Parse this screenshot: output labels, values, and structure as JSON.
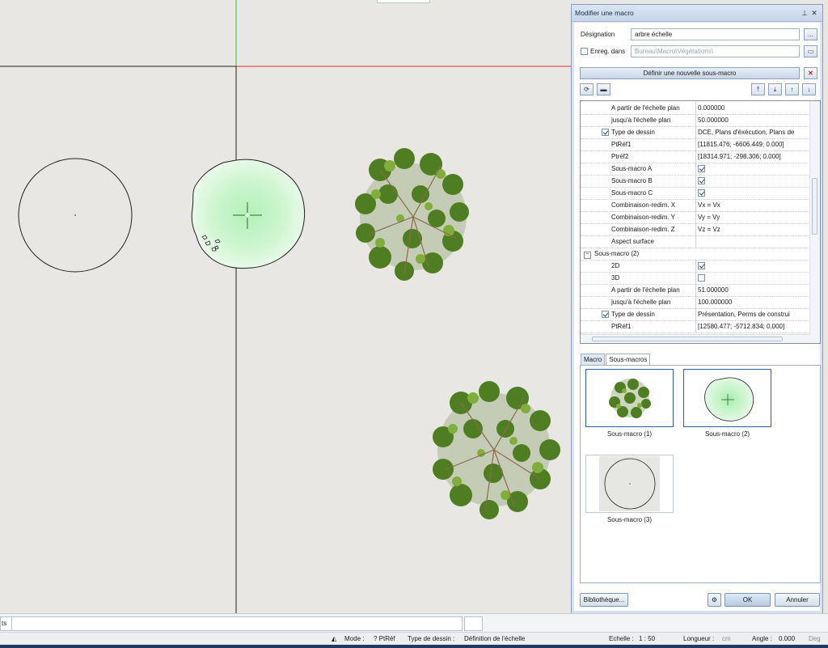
{
  "panel": {
    "title": "Modifier une macro",
    "pin_icon": "pin-icon",
    "close_glyph": "✕",
    "designation_label": "Désignation",
    "designation_value": "arbre échelle",
    "browse_label": "...",
    "enreg_label": "Enreg. dans",
    "enreg_path": "Bureau\\Macro\\Végétations\\",
    "define_button": "Définir une nouvelle sous-macro",
    "grid_rows": [
      {
        "key": "A partir de l'échelle plan",
        "value": "0.000000"
      },
      {
        "key": "jusqu'à l'échelle plan",
        "value": "50.000000"
      },
      {
        "key": "Type de dessin",
        "value": "DCE, Plans d'éxécution, Plans de",
        "checked_key": true
      },
      {
        "key": "PtRéf1",
        "value": "[11815.476; -6606.449; 0.000]"
      },
      {
        "key": "Ptréf2",
        "value": "[18314.971; -298.306; 0.000]"
      },
      {
        "key": "Sous-macro A",
        "check": true
      },
      {
        "key": "Sous-macro B",
        "check": true
      },
      {
        "key": "Sous-macro C",
        "check": true
      },
      {
        "key": "Combinaison-redim. X",
        "value": "Vx = Vx"
      },
      {
        "key": "Combinaison-redim. Y",
        "value": "Vy = Vy"
      },
      {
        "key": "Combinaison-redim. Z",
        "value": "Vz = Vz"
      },
      {
        "key": "Aspect surface",
        "value": ""
      },
      {
        "key": "Sous-macro (2)",
        "group": true
      },
      {
        "key": "2D",
        "check": true
      },
      {
        "key": "3D",
        "check": false
      },
      {
        "key": "A partir de l'échelle plan",
        "value": "51.000000"
      },
      {
        "key": "jusqu'à l'échelle plan",
        "value": "100.000000"
      },
      {
        "key": "Type de dessin",
        "value": "Présentation, Perms de construi",
        "checked_key": true
      },
      {
        "key": "PtRéf1",
        "value": "[12580.477; -5712.834; 0.000]"
      }
    ],
    "tabs": [
      "Macro",
      "Sous-macros"
    ],
    "thumbnails": [
      "Sous-macro (1)",
      "Sous-macro (2)",
      "Sous-macro (3)"
    ],
    "library_button": "Bibliothèque...",
    "ok_button": "OK",
    "cancel_button": "Annuler"
  },
  "statusbar": {
    "left_tab": "ts",
    "mode_label": "Mode :",
    "mode_value": "? PtRéf",
    "type_label": "Type de dessin :",
    "type_value": "Définition de l'échelle",
    "scale_label": "Echelle :",
    "scale_value": "1 : 50",
    "length_label": "Longueur :",
    "length_value": "cm",
    "angle_label": "Angle :",
    "angle_value": "0.000",
    "angle_unit": "Deg"
  }
}
